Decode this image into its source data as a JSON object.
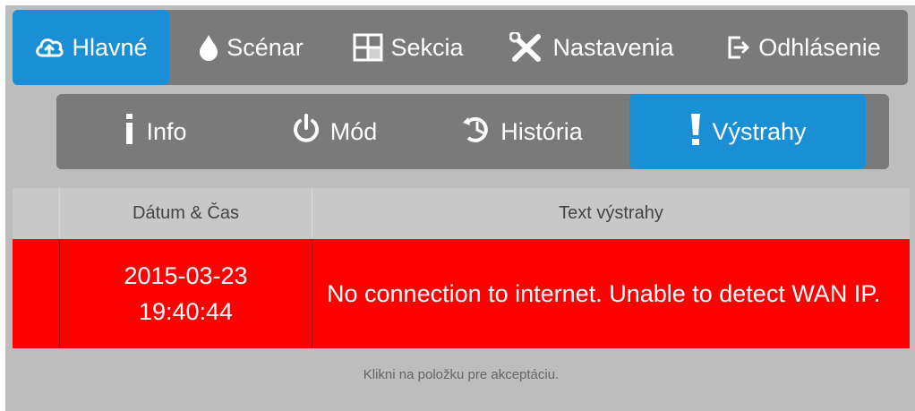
{
  "main_nav": {
    "items": [
      {
        "label": "Hlavné",
        "icon": "cloud-upload-icon",
        "active": true
      },
      {
        "label": "Scénar",
        "icon": "drop-icon",
        "active": false
      },
      {
        "label": "Sekcia",
        "icon": "grid-section-icon",
        "active": false
      },
      {
        "label": "Nastavenia",
        "icon": "wrench-screwdriver-icon",
        "active": false
      },
      {
        "label": "Odhlásenie",
        "icon": "logout-icon",
        "active": false
      }
    ]
  },
  "sub_nav": {
    "items": [
      {
        "label": "Info",
        "icon": "info-icon",
        "active": false
      },
      {
        "label": "Mód",
        "icon": "power-icon",
        "active": false
      },
      {
        "label": "História",
        "icon": "history-icon",
        "active": false
      },
      {
        "label": "Výstrahy",
        "icon": "exclamation-icon",
        "active": true
      }
    ]
  },
  "alerts_table": {
    "columns": [
      "Dátum & Čas",
      "Text výstrahy"
    ],
    "rows": [
      {
        "date": "2015-03-23",
        "time": "19:40:44",
        "text": "No connection to internet. Unable to detect WAN IP."
      }
    ]
  },
  "hint": "Klikni na položku pre akceptáciu.",
  "colors": {
    "accent": "#1a8fd6",
    "nav_bg": "#7a7a7a",
    "panel_bg": "#bdbdbd",
    "alert_row": "#ff0000"
  }
}
